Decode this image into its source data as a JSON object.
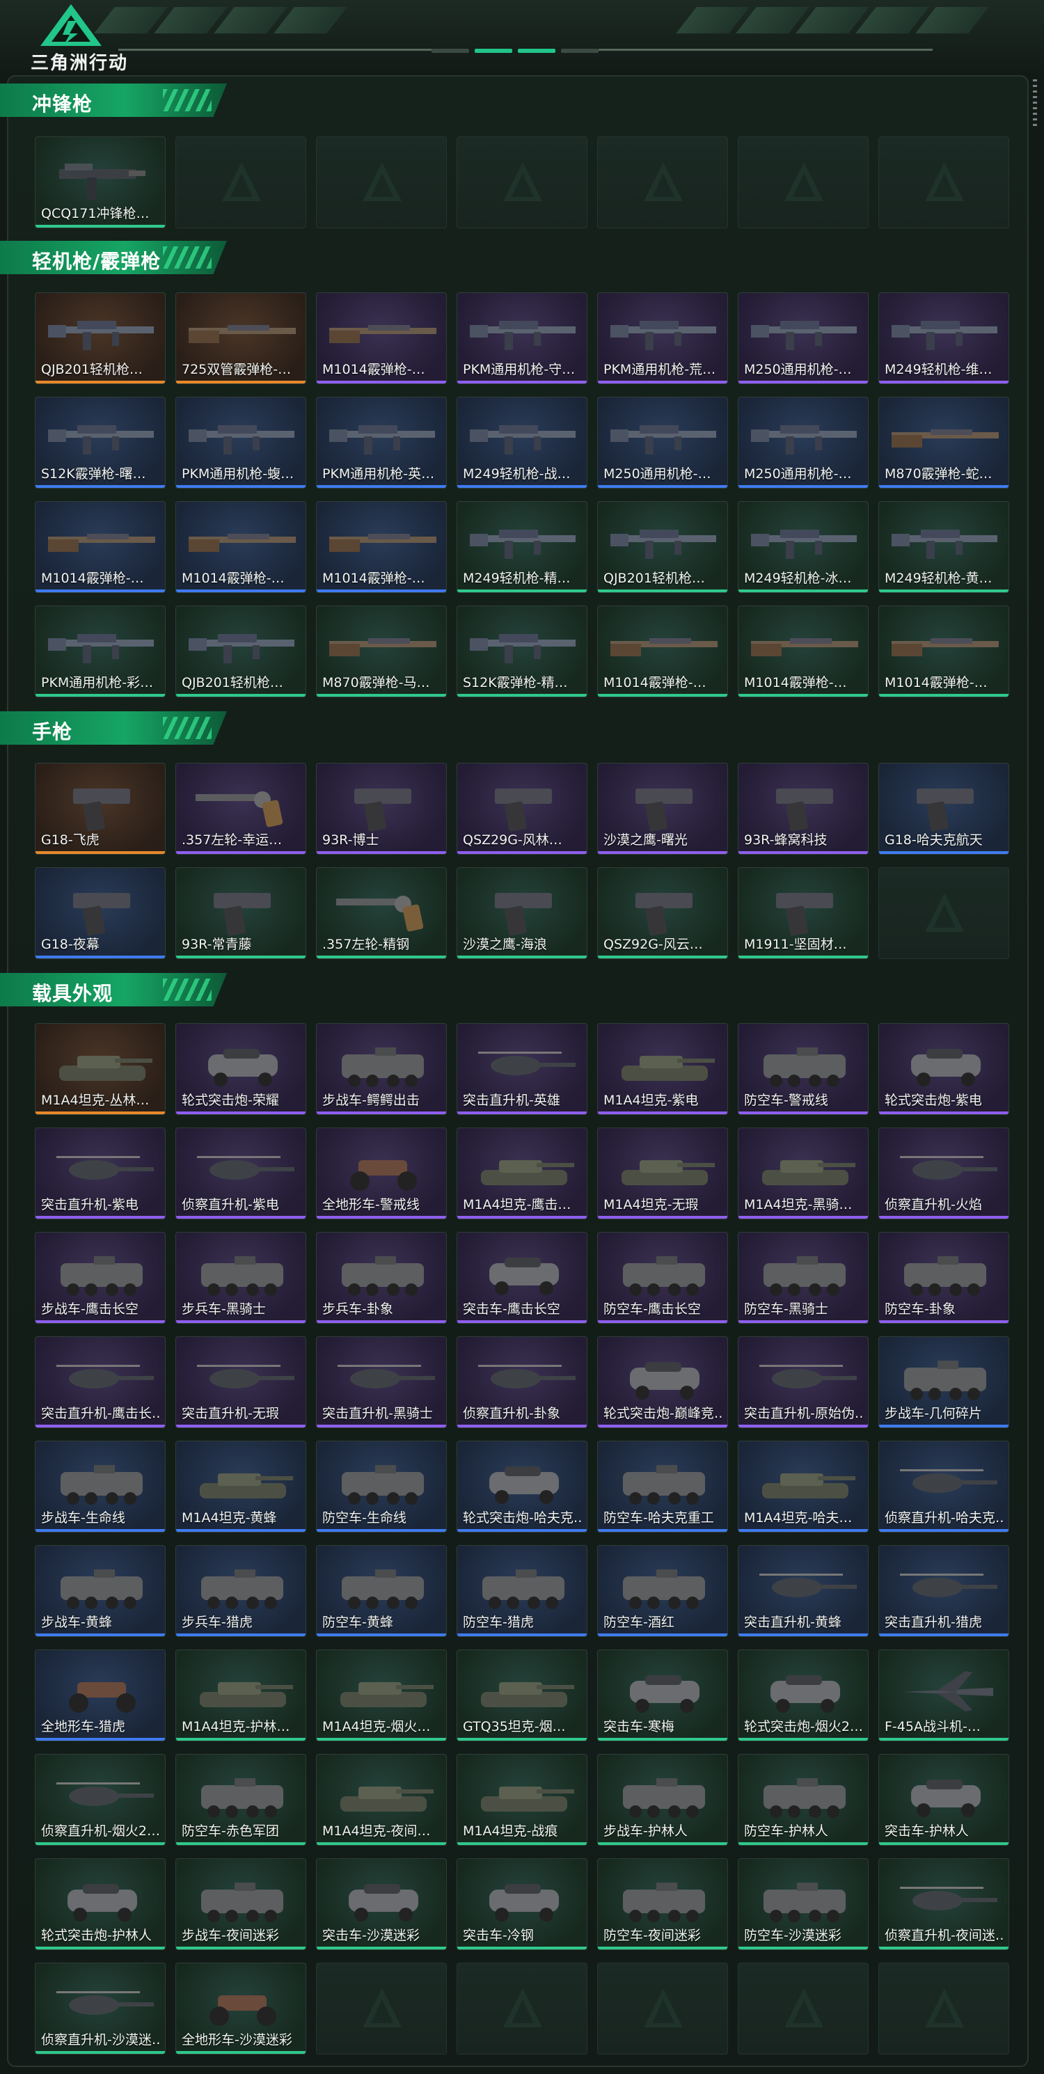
{
  "app_title": "三角洲行动",
  "sections": [
    {
      "title": "冲锋枪",
      "items": [
        {
          "label": "QCQ171冲锋枪…",
          "rarity": "green",
          "art": "smg"
        },
        {
          "label": "",
          "rarity": "empty"
        },
        {
          "label": "",
          "rarity": "empty"
        },
        {
          "label": "",
          "rarity": "empty"
        },
        {
          "label": "",
          "rarity": "empty"
        },
        {
          "label": "",
          "rarity": "empty"
        },
        {
          "label": "",
          "rarity": "empty"
        }
      ]
    },
    {
      "title": "轻机枪/霰弹枪",
      "items": [
        {
          "label": "QJB201轻机枪…",
          "rarity": "orange",
          "art": "rifle"
        },
        {
          "label": "725双管霰弹枪-…",
          "rarity": "orange",
          "art": "shotgun"
        },
        {
          "label": "M1014霰弹枪-…",
          "rarity": "purple",
          "art": "shotgun"
        },
        {
          "label": "PKM通用机枪-守…",
          "rarity": "purple",
          "art": "rifle"
        },
        {
          "label": "PKM通用机枪-荒…",
          "rarity": "purple",
          "art": "rifle"
        },
        {
          "label": "M250通用机枪-…",
          "rarity": "purple",
          "art": "rifle"
        },
        {
          "label": "M249轻机枪-维…",
          "rarity": "purple",
          "art": "rifle"
        },
        {
          "label": "S12K霰弹枪-曙…",
          "rarity": "blue",
          "art": "rifle"
        },
        {
          "label": "PKM通用机枪-蝮…",
          "rarity": "blue",
          "art": "rifle"
        },
        {
          "label": "PKM通用机枪-英…",
          "rarity": "blue",
          "art": "rifle"
        },
        {
          "label": "M249轻机枪-战…",
          "rarity": "blue",
          "art": "rifle"
        },
        {
          "label": "M250通用机枪-…",
          "rarity": "blue",
          "art": "rifle"
        },
        {
          "label": "M250通用机枪-…",
          "rarity": "blue",
          "art": "rifle"
        },
        {
          "label": "M870霰弹枪-蛇…",
          "rarity": "blue",
          "art": "shotgun"
        },
        {
          "label": "M1014霰弹枪-…",
          "rarity": "blue",
          "art": "shotgun"
        },
        {
          "label": "M1014霰弹枪-…",
          "rarity": "blue",
          "art": "shotgun"
        },
        {
          "label": "M1014霰弹枪-…",
          "rarity": "blue",
          "art": "shotgun"
        },
        {
          "label": "M249轻机枪-精…",
          "rarity": "green",
          "art": "rifle"
        },
        {
          "label": "QJB201轻机枪…",
          "rarity": "green",
          "art": "rifle"
        },
        {
          "label": "M249轻机枪-冰…",
          "rarity": "green",
          "art": "rifle"
        },
        {
          "label": "M249轻机枪-黄…",
          "rarity": "green",
          "art": "rifle"
        },
        {
          "label": "PKM通用机枪-彩…",
          "rarity": "green",
          "art": "rifle"
        },
        {
          "label": "QJB201轻机枪…",
          "rarity": "green",
          "art": "rifle"
        },
        {
          "label": "M870霰弹枪-马…",
          "rarity": "green",
          "art": "shotgun"
        },
        {
          "label": "S12K霰弹枪-精…",
          "rarity": "green",
          "art": "rifle"
        },
        {
          "label": "M1014霰弹枪-…",
          "rarity": "green",
          "art": "shotgun"
        },
        {
          "label": "M1014霰弹枪-…",
          "rarity": "green",
          "art": "shotgun"
        },
        {
          "label": "M1014霰弹枪-…",
          "rarity": "green",
          "art": "shotgun"
        }
      ]
    },
    {
      "title": "手枪",
      "items": [
        {
          "label": "G18-飞虎",
          "rarity": "orange",
          "art": "pistol"
        },
        {
          "label": ".357左轮-幸运…",
          "rarity": "purple",
          "art": "revolver"
        },
        {
          "label": "93R-博士",
          "rarity": "purple",
          "art": "pistol"
        },
        {
          "label": "QSZ29G-风林…",
          "rarity": "purple",
          "art": "pistol"
        },
        {
          "label": "沙漠之鹰-曙光",
          "rarity": "purple",
          "art": "pistol"
        },
        {
          "label": "93R-蜂窝科技",
          "rarity": "purple",
          "art": "pistol"
        },
        {
          "label": "G18-哈夫克航天",
          "rarity": "blue",
          "art": "pistol"
        },
        {
          "label": "G18-夜幕",
          "rarity": "blue",
          "art": "pistol"
        },
        {
          "label": "93R-常青藤",
          "rarity": "green",
          "art": "pistol"
        },
        {
          "label": ".357左轮-精钢",
          "rarity": "green",
          "art": "revolver"
        },
        {
          "label": "沙漠之鹰-海浪",
          "rarity": "green",
          "art": "pistol"
        },
        {
          "label": "QSZ92G-风云…",
          "rarity": "green",
          "art": "pistol"
        },
        {
          "label": "M1911-坚固材…",
          "rarity": "green",
          "art": "pistol"
        },
        {
          "label": "",
          "rarity": "empty"
        }
      ]
    },
    {
      "title": "载具外观",
      "items": [
        {
          "label": "M1A4坦克-丛林…",
          "rarity": "orange",
          "art": "tank"
        },
        {
          "label": "轮式突击炮-荣耀",
          "rarity": "purple",
          "art": "car"
        },
        {
          "label": "步战车-鳄鳄出击",
          "rarity": "purple",
          "art": "apc"
        },
        {
          "label": "突击直升机-英雄",
          "rarity": "purple",
          "art": "heli"
        },
        {
          "label": "M1A4坦克-紫电",
          "rarity": "purple",
          "art": "tank"
        },
        {
          "label": "防空车-警戒线",
          "rarity": "purple",
          "art": "apc"
        },
        {
          "label": "轮式突击炮-紫电",
          "rarity": "purple",
          "art": "car"
        },
        {
          "label": "突击直升机-紫电",
          "rarity": "purple",
          "art": "heli"
        },
        {
          "label": "侦察直升机-紫电",
          "rarity": "purple",
          "art": "heli"
        },
        {
          "label": "全地形车-警戒线",
          "rarity": "purple",
          "art": "atv"
        },
        {
          "label": "M1A4坦克-鹰击…",
          "rarity": "purple",
          "art": "tank"
        },
        {
          "label": "M1A4坦克-无瑕",
          "rarity": "purple",
          "art": "tank"
        },
        {
          "label": "M1A4坦克-黑骑…",
          "rarity": "purple",
          "art": "tank"
        },
        {
          "label": "侦察直升机-火焰",
          "rarity": "purple",
          "art": "heli"
        },
        {
          "label": "步战车-鹰击长空",
          "rarity": "purple",
          "art": "apc"
        },
        {
          "label": "步兵车-黑骑士",
          "rarity": "purple",
          "art": "apc"
        },
        {
          "label": "步兵车-卦象",
          "rarity": "purple",
          "art": "apc"
        },
        {
          "label": "突击车-鹰击长空",
          "rarity": "purple",
          "art": "car"
        },
        {
          "label": "防空车-鹰击长空",
          "rarity": "purple",
          "art": "apc"
        },
        {
          "label": "防空车-黑骑士",
          "rarity": "purple",
          "art": "apc"
        },
        {
          "label": "防空车-卦象",
          "rarity": "purple",
          "art": "apc"
        },
        {
          "label": "突击直升机-鹰击长…",
          "rarity": "purple",
          "art": "heli"
        },
        {
          "label": "突击直升机-无瑕",
          "rarity": "purple",
          "art": "heli"
        },
        {
          "label": "突击直升机-黑骑士",
          "rarity": "purple",
          "art": "heli"
        },
        {
          "label": "侦察直升机-卦象",
          "rarity": "purple",
          "art": "heli"
        },
        {
          "label": "轮式突击炮-巅峰竞…",
          "rarity": "purple",
          "art": "car"
        },
        {
          "label": "突击直升机-原始伪…",
          "rarity": "purple",
          "art": "heli"
        },
        {
          "label": "步战车-几何碎片",
          "rarity": "blue",
          "art": "apc"
        },
        {
          "label": "步战车-生命线",
          "rarity": "blue",
          "art": "apc"
        },
        {
          "label": "M1A4坦克-黄蜂",
          "rarity": "blue",
          "art": "tank"
        },
        {
          "label": "防空车-生命线",
          "rarity": "blue",
          "art": "apc"
        },
        {
          "label": "轮式突击炮-哈夫克…",
          "rarity": "blue",
          "art": "car"
        },
        {
          "label": "防空车-哈夫克重工",
          "rarity": "blue",
          "art": "apc"
        },
        {
          "label": "M1A4坦克-哈夫…",
          "rarity": "blue",
          "art": "tank"
        },
        {
          "label": "侦察直升机-哈夫克…",
          "rarity": "blue",
          "art": "heli"
        },
        {
          "label": "步战车-黄蜂",
          "rarity": "blue",
          "art": "apc"
        },
        {
          "label": "步兵车-猎虎",
          "rarity": "blue",
          "art": "apc"
        },
        {
          "label": "防空车-黄蜂",
          "rarity": "blue",
          "art": "apc"
        },
        {
          "label": "防空车-猎虎",
          "rarity": "blue",
          "art": "apc"
        },
        {
          "label": "防空车-酒红",
          "rarity": "blue",
          "art": "apc"
        },
        {
          "label": "突击直升机-黄蜂",
          "rarity": "blue",
          "art": "heli"
        },
        {
          "label": "突击直升机-猎虎",
          "rarity": "blue",
          "art": "heli"
        },
        {
          "label": "全地形车-猎虎",
          "rarity": "blue",
          "art": "atv"
        },
        {
          "label": "M1A4坦克-护林…",
          "rarity": "green",
          "art": "tank"
        },
        {
          "label": "M1A4坦克-烟火…",
          "rarity": "green",
          "art": "tank"
        },
        {
          "label": "GTQ35坦克-烟…",
          "rarity": "green",
          "art": "tank"
        },
        {
          "label": "突击车-寒梅",
          "rarity": "green",
          "art": "car"
        },
        {
          "label": "轮式突击炮-烟火2…",
          "rarity": "green",
          "art": "car"
        },
        {
          "label": "F-45A战斗机-…",
          "rarity": "green",
          "art": "jet"
        },
        {
          "label": "侦察直升机-烟火2…",
          "rarity": "green",
          "art": "heli"
        },
        {
          "label": "防空车-赤色军团",
          "rarity": "green",
          "art": "apc"
        },
        {
          "label": "M1A4坦克-夜间…",
          "rarity": "green",
          "art": "tank"
        },
        {
          "label": "M1A4坦克-战痕",
          "rarity": "green",
          "art": "tank"
        },
        {
          "label": "步战车-护林人",
          "rarity": "green",
          "art": "apc"
        },
        {
          "label": "防空车-护林人",
          "rarity": "green",
          "art": "apc"
        },
        {
          "label": "突击车-护林人",
          "rarity": "green",
          "art": "car"
        },
        {
          "label": "轮式突击炮-护林人",
          "rarity": "green",
          "art": "car"
        },
        {
          "label": "步战车-夜间迷彩",
          "rarity": "green",
          "art": "apc"
        },
        {
          "label": "突击车-沙漠迷彩",
          "rarity": "green",
          "art": "car"
        },
        {
          "label": "突击车-冷钢",
          "rarity": "green",
          "art": "car"
        },
        {
          "label": "防空车-夜间迷彩",
          "rarity": "green",
          "art": "apc"
        },
        {
          "label": "防空车-沙漠迷彩",
          "rarity": "green",
          "art": "apc"
        },
        {
          "label": "侦察直升机-夜间迷…",
          "rarity": "green",
          "art": "heli"
        },
        {
          "label": "侦察直升机-沙漠迷…",
          "rarity": "green",
          "art": "heli"
        },
        {
          "label": "全地形车-沙漠迷彩",
          "rarity": "green",
          "art": "atv"
        },
        {
          "label": "",
          "rarity": "empty"
        },
        {
          "label": "",
          "rarity": "empty"
        },
        {
          "label": "",
          "rarity": "empty"
        },
        {
          "label": "",
          "rarity": "empty"
        },
        {
          "label": "",
          "rarity": "empty"
        }
      ]
    }
  ],
  "colors": {
    "orange": "#e8892a",
    "purple": "#8f5ff0",
    "blue": "#3f7bf0",
    "green": "#2fc98c",
    "accent": "#16a564"
  }
}
